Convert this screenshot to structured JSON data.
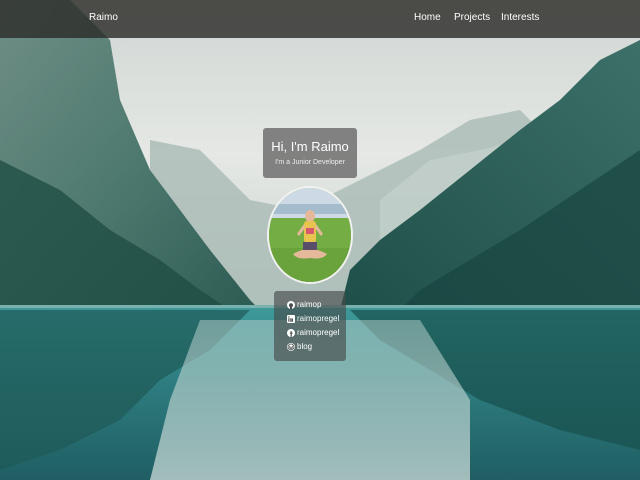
{
  "navbar": {
    "brand": "Raimo",
    "links": [
      {
        "label": "Home"
      },
      {
        "label": "Projects"
      },
      {
        "label": "Interests"
      }
    ]
  },
  "hero": {
    "title": "Hi, I'm Raimo",
    "subtitle": "I'm a Junior Developer"
  },
  "social": [
    {
      "icon": "github-icon",
      "label": "raimop"
    },
    {
      "icon": "linkedin-icon",
      "label": "raimopregel"
    },
    {
      "icon": "facebook-icon",
      "label": "raimopregel"
    },
    {
      "icon": "wordpress-icon",
      "label": "blog"
    }
  ],
  "colors": {
    "navbar": "#2d2d2a",
    "lake": "#2e7f82",
    "sky": "#dfe4e0"
  }
}
